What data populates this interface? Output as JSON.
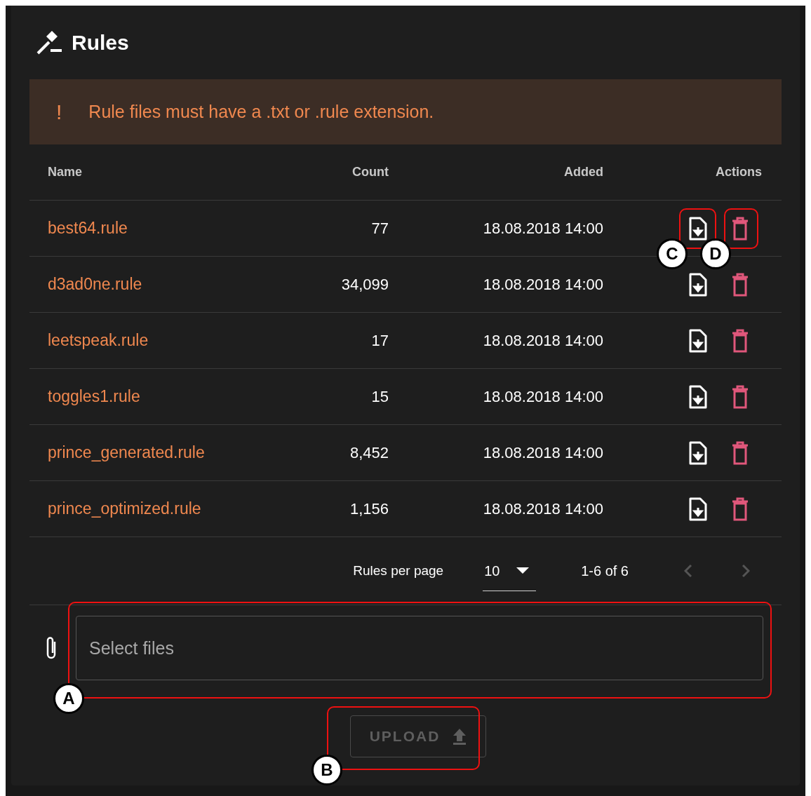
{
  "title": "Rules",
  "alert": {
    "icon": "!",
    "text": "Rule files must have a .txt or .rule extension."
  },
  "table": {
    "columns": [
      "Name",
      "Count",
      "Added",
      "Actions"
    ],
    "rows": [
      {
        "name": "best64.rule",
        "count": "77",
        "added": "18.08.2018 14:00"
      },
      {
        "name": "d3ad0ne.rule",
        "count": "34,099",
        "added": "18.08.2018 14:00"
      },
      {
        "name": "leetspeak.rule",
        "count": "17",
        "added": "18.08.2018 14:00"
      },
      {
        "name": "toggles1.rule",
        "count": "15",
        "added": "18.08.2018 14:00"
      },
      {
        "name": "prince_generated.rule",
        "count": "8,452",
        "added": "18.08.2018 14:00"
      },
      {
        "name": "prince_optimized.rule",
        "count": "1,156",
        "added": "18.08.2018 14:00"
      }
    ]
  },
  "pagination": {
    "label": "Rules per page",
    "per_page": "10",
    "range": "1-6 of 6",
    "prev_disabled": true,
    "next_disabled": true
  },
  "upload": {
    "placeholder": "Select files",
    "button": "UPLOAD",
    "button_disabled": true
  },
  "callouts": [
    {
      "label": "A",
      "kind": "field"
    },
    {
      "label": "B",
      "kind": "upload"
    },
    {
      "label": "C",
      "kind": "download"
    },
    {
      "label": "D",
      "kind": "delete"
    }
  ]
}
